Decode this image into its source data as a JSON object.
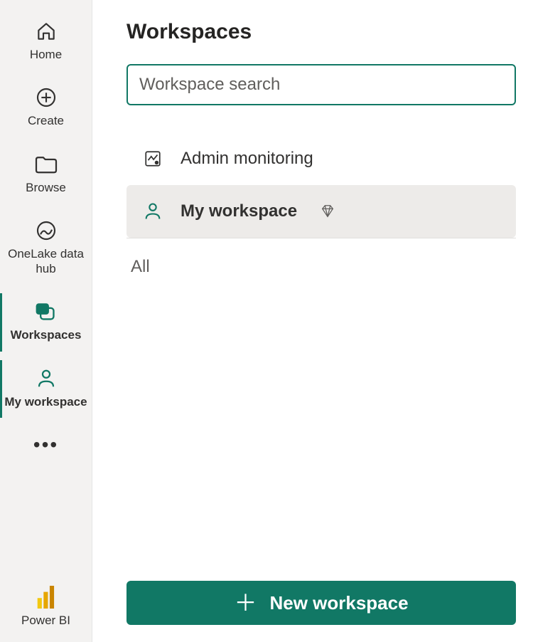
{
  "nav": {
    "items": [
      {
        "label": "Home"
      },
      {
        "label": "Create"
      },
      {
        "label": "Browse"
      },
      {
        "label": "OneLake data hub"
      },
      {
        "label": "Workspaces"
      },
      {
        "label": "My workspace"
      }
    ],
    "footer_label": "Power BI"
  },
  "panel": {
    "title": "Workspaces",
    "search_placeholder": "Workspace search",
    "items": [
      {
        "label": "Admin monitoring"
      },
      {
        "label": "My workspace"
      }
    ],
    "section_label": "All",
    "new_button_label": "New workspace"
  },
  "colors": {
    "accent": "#117865"
  }
}
